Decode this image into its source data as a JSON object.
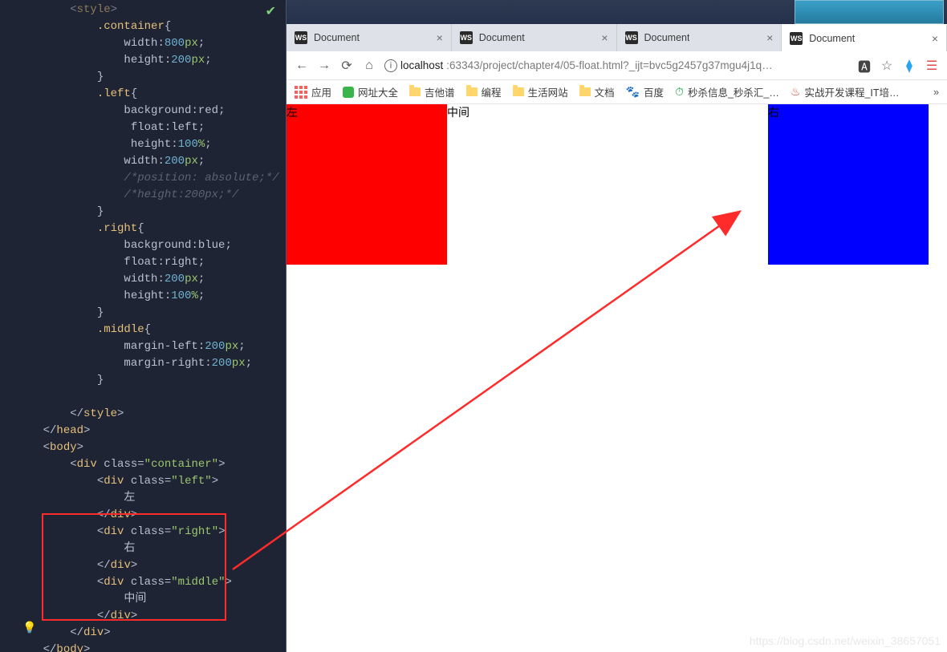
{
  "ide": {
    "lines": [
      {
        "ind": 2,
        "html": "<span class='pun'>&lt;</span><span class='tok-tag'>style</span><span class='pun'>&gt;</span>",
        "faded": true
      },
      {
        "ind": 3,
        "html": "<span class='tok-sel'>.container</span><span class='pun'>{</span>"
      },
      {
        "ind": 4,
        "html": "<span class='tok-prop'>width</span><span class='pun'>:</span><span class='tok-num'>800</span><span class='tok-unit'>px</span><span class='pun'>;</span>"
      },
      {
        "ind": 4,
        "html": "<span class='tok-prop'>height</span><span class='pun'>:</span><span class='tok-num'>200</span><span class='tok-unit'>px</span><span class='pun'>;</span>"
      },
      {
        "ind": 3,
        "html": "<span class='pun'>}</span>"
      },
      {
        "ind": 3,
        "html": "<span class='tok-sel'>.left</span><span class='pun'>{</span>"
      },
      {
        "ind": 4,
        "html": "<span class='tok-prop'>background</span><span class='pun'>:</span><span class='tok-prop'>red</span><span class='pun'>;</span>"
      },
      {
        "ind": 4,
        "html": " <span class='tok-prop'>float</span><span class='pun'>:</span><span class='tok-prop'>left</span><span class='pun'>;</span>"
      },
      {
        "ind": 4,
        "html": " <span class='tok-prop'>height</span><span class='pun'>:</span><span class='tok-num'>100</span><span class='tok-unit'>%</span><span class='pun'>;</span>"
      },
      {
        "ind": 4,
        "html": "<span class='tok-prop'>width</span><span class='pun'>:</span><span class='tok-num'>200</span><span class='tok-unit'>px</span><span class='pun'>;</span>"
      },
      {
        "ind": 4,
        "html": "<span class='tok-cmt'>/*position: absolute;*/</span>"
      },
      {
        "ind": 4,
        "html": "<span class='tok-cmt'>/*height:200px;*/</span>"
      },
      {
        "ind": 3,
        "html": "<span class='pun'>}</span>"
      },
      {
        "ind": 3,
        "html": "<span class='tok-sel'>.right</span><span class='pun'>{</span>"
      },
      {
        "ind": 4,
        "html": "<span class='tok-prop'>background</span><span class='pun'>:</span><span class='tok-prop'>blue</span><span class='pun'>;</span>"
      },
      {
        "ind": 4,
        "html": "<span class='tok-prop'>float</span><span class='pun'>:</span><span class='tok-prop'>right</span><span class='pun'>;</span>"
      },
      {
        "ind": 4,
        "html": "<span class='tok-prop'>width</span><span class='pun'>:</span><span class='tok-num'>200</span><span class='tok-unit'>px</span><span class='pun'>;</span>"
      },
      {
        "ind": 4,
        "html": "<span class='tok-prop'>height</span><span class='pun'>:</span><span class='tok-num'>100</span><span class='tok-unit'>%</span><span class='pun'>;</span>"
      },
      {
        "ind": 3,
        "html": "<span class='pun'>}</span>"
      },
      {
        "ind": 3,
        "html": "<span class='tok-sel'>.middle</span><span class='pun'>{</span>"
      },
      {
        "ind": 4,
        "html": "<span class='tok-prop'>margin-left</span><span class='pun'>:</span><span class='tok-num'>200</span><span class='tok-unit'>px</span><span class='pun'>;</span>"
      },
      {
        "ind": 4,
        "html": "<span class='tok-prop'>margin-right</span><span class='pun'>:</span><span class='tok-num'>200</span><span class='tok-unit'>px</span><span class='pun'>;</span>"
      },
      {
        "ind": 3,
        "html": "<span class='pun'>}</span>"
      },
      {
        "ind": 0,
        "html": " "
      },
      {
        "ind": 2,
        "html": "<span class='pun'>&lt;/</span><span class='tok-tag'>style</span><span class='pun'>&gt;</span>"
      },
      {
        "ind": 1,
        "html": "<span class='pun'>&lt;/</span><span class='tok-tag'>head</span><span class='pun'>&gt;</span>"
      },
      {
        "ind": 1,
        "html": "<span class='pun'>&lt;</span><span class='tok-tag'>body</span><span class='pun'>&gt;</span>"
      },
      {
        "ind": 2,
        "html": "<span class='pun'>&lt;</span><span class='tok-tag'>div</span> <span class='tok-attr'>class</span><span class='pun'>=</span><span class='tok-str'>\"container\"</span><span class='pun'>&gt;</span>"
      },
      {
        "ind": 3,
        "html": "<span class='pun'>&lt;</span><span class='tok-tag'>div</span> <span class='tok-attr'>class</span><span class='pun'>=</span><span class='tok-str'>\"left\"</span><span class='pun'>&gt;</span>"
      },
      {
        "ind": 4,
        "html": "<span class='tok-text'>左</span>"
      },
      {
        "ind": 3,
        "html": "<span class='pun'>&lt;/</span><span class='tok-tag'>div</span><span class='pun'>&gt;</span>"
      },
      {
        "ind": 3,
        "html": "<span class='pun'>&lt;</span><span class='tok-tag'>div</span> <span class='tok-attr'>class</span><span class='pun'>=</span><span class='tok-str'>\"right\"</span><span class='pun'>&gt;</span>"
      },
      {
        "ind": 4,
        "html": "<span class='tok-text'>右</span>"
      },
      {
        "ind": 3,
        "html": "<span class='pun'>&lt;/</span><span class='tok-tag'>div</span><span class='pun'>&gt;</span>"
      },
      {
        "ind": 3,
        "html": "<span class='pun'>&lt;</span><span class='tok-tag'>div</span> <span class='tok-attr'>class</span><span class='pun'>=</span><span class='tok-str'>\"middle\"</span><span class='pun'>&gt;</span>"
      },
      {
        "ind": 4,
        "html": "<span class='tok-text'>中间</span>"
      },
      {
        "ind": 3,
        "html": "<span class='pun'>&lt;/</span><span class='tok-tag'>div</span><span class='pun'>&gt;</span>"
      },
      {
        "ind": 2,
        "html": "<span class='pun'>&lt;/</span><span class='tok-tag'>div</span><span class='pun'>&gt;</span>"
      },
      {
        "ind": 1,
        "html": "<span class='pun'>&lt;/</span><span class='tok-tag'>body</span><span class='pun'>&gt;</span>"
      }
    ]
  },
  "browser": {
    "tabs": [
      {
        "label": "Document",
        "active": false
      },
      {
        "label": "Document",
        "active": false
      },
      {
        "label": "Document",
        "active": false
      },
      {
        "label": "Document",
        "active": true
      }
    ],
    "addr": {
      "host": "localhost",
      "path": ":63343/project/chapter4/05-float.html?_ijt=bvc5g2457g37mgu4j1q…"
    },
    "bookmarks": {
      "apps": "应用",
      "items": [
        {
          "icon": "hc",
          "label": "网址大全"
        },
        {
          "icon": "fld",
          "label": "吉他谱"
        },
        {
          "icon": "fld",
          "label": "编程"
        },
        {
          "icon": "fld",
          "label": "生活网站"
        },
        {
          "icon": "fld",
          "label": "文档"
        },
        {
          "icon": "paw",
          "label": "百度"
        },
        {
          "icon": "clk",
          "label": "秒杀信息_秒杀汇_…"
        },
        {
          "icon": "fire",
          "label": "实战开发课程_IT培…"
        }
      ]
    },
    "page": {
      "left": "左",
      "right": "右",
      "middle": "中间"
    }
  },
  "watermark": "https://blog.csdn.net/weixin_38657051"
}
